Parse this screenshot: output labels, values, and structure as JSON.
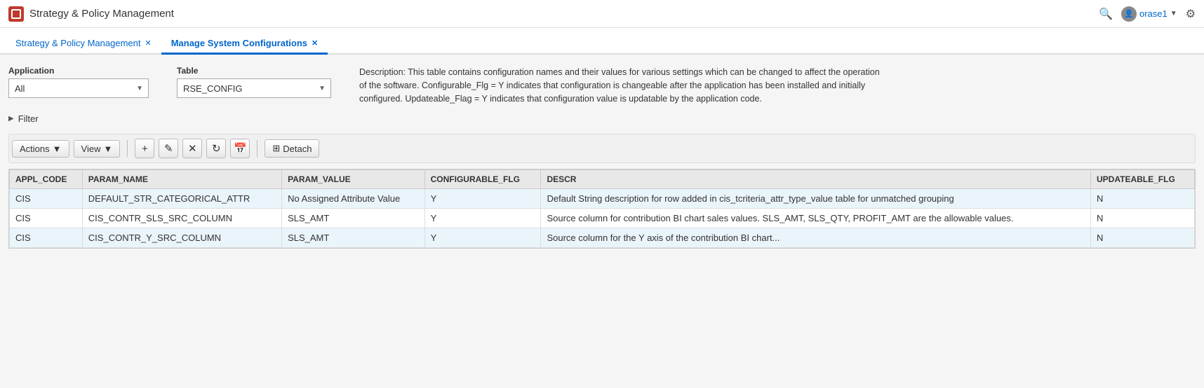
{
  "topbar": {
    "title": "Strategy & Policy Management",
    "logo_alt": "Oracle Logo",
    "search_icon": "🔍",
    "user_name": "orase1",
    "user_icon": "👤",
    "chevron": "▼",
    "settings_icon": "⚙"
  },
  "tabs": [
    {
      "id": "tab1",
      "label": "Strategy & Policy Management",
      "active": false,
      "closable": true
    },
    {
      "id": "tab2",
      "label": "Manage System Configurations",
      "active": true,
      "closable": true
    }
  ],
  "form": {
    "application_label": "Application",
    "application_value": "All",
    "table_label": "Table",
    "table_value": "RSE_CONFIG",
    "description": "Description: This table contains configuration names and their values for various settings which can be changed to affect the operation of the software. Configurable_Flg = Y indicates that configuration is changeable after the application has been installed and initially configured. Updateable_Flag = Y indicates that configuration value is updatable by the application code."
  },
  "filter": {
    "label": "Filter",
    "icon": "▶"
  },
  "toolbar": {
    "actions_label": "Actions",
    "view_label": "View",
    "add_icon": "+",
    "edit_icon": "✏",
    "delete_icon": "✕",
    "refresh_icon": "↻",
    "calendar_icon": "📅",
    "detach_label": "Detach",
    "detach_icon": "⊞",
    "dropdown_icon": "▼"
  },
  "table": {
    "columns": [
      "APPL_CODE",
      "PARAM_NAME",
      "PARAM_VALUE",
      "CONFIGURABLE_FLG",
      "DESCR",
      "UPDATEABLE_FLG"
    ],
    "rows": [
      {
        "appl_code": "CIS",
        "param_name": "DEFAULT_STR_CATEGORICAL_ATTR",
        "param_value": "No Assigned Attribute Value",
        "configurable_flg": "Y",
        "descr": "Default String description for row added in cis_tcriteria_attr_type_value table for unmatched grouping",
        "updateable_flg": "N"
      },
      {
        "appl_code": "CIS",
        "param_name": "CIS_CONTR_SLS_SRC_COLUMN",
        "param_value": "SLS_AMT",
        "configurable_flg": "Y",
        "descr": "Source column for contribution BI chart sales values. SLS_AMT, SLS_QTY, PROFIT_AMT are the allowable values.",
        "updateable_flg": "N"
      },
      {
        "appl_code": "CIS",
        "param_name": "CIS_CONTR_Y_SRC_COLUMN",
        "param_value": "SLS_AMT",
        "configurable_flg": "Y",
        "descr": "Source column for the Y axis of the contribution BI chart...",
        "updateable_flg": "N"
      }
    ]
  }
}
